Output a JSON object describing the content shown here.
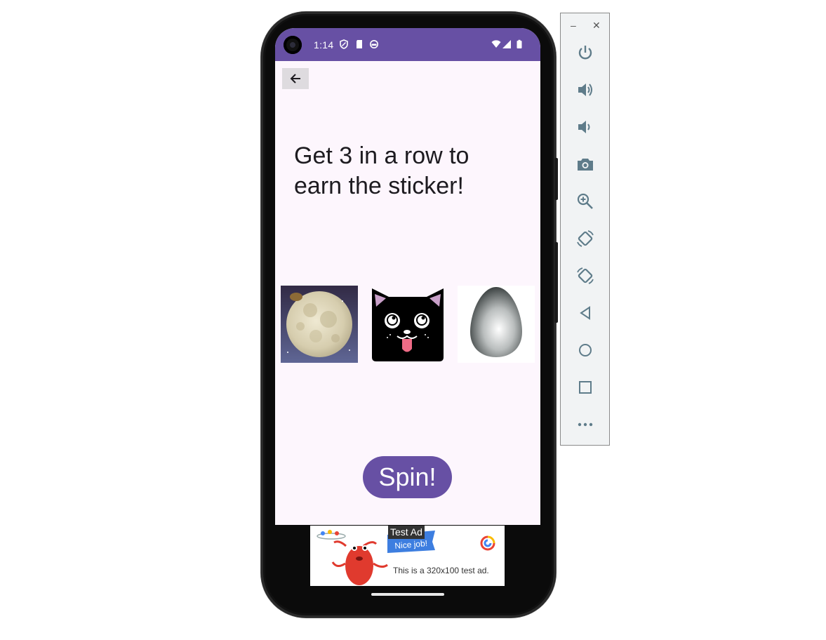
{
  "status_bar": {
    "time": "1:14",
    "icons": [
      "shield-icon",
      "sd-card-icon",
      "sync-icon",
      "wifi-icon",
      "signal-icon",
      "battery-icon"
    ]
  },
  "app": {
    "back_icon": "arrow-left-icon",
    "instructions": "Get 3 in a row to earn the sticker!",
    "slots": [
      "moon",
      "black-cat",
      "silver-egg"
    ],
    "spin_label": "Spin!"
  },
  "ad": {
    "label": "Test Ad",
    "banner": "Nice job!",
    "text": "This is a 320x100 test ad."
  },
  "emulator_toolbar": {
    "items": [
      "minimize-icon",
      "close-icon",
      "power-icon",
      "volume-up-icon",
      "volume-down-icon",
      "camera-icon",
      "zoom-icon",
      "rotate-left-icon",
      "rotate-right-icon",
      "back-triangle-icon",
      "home-circle-icon",
      "overview-square-icon",
      "more-icon"
    ]
  },
  "colors": {
    "primary": "#6750a4",
    "background": "#fdf6fd",
    "toolbar_icon": "#5f7c8a"
  }
}
